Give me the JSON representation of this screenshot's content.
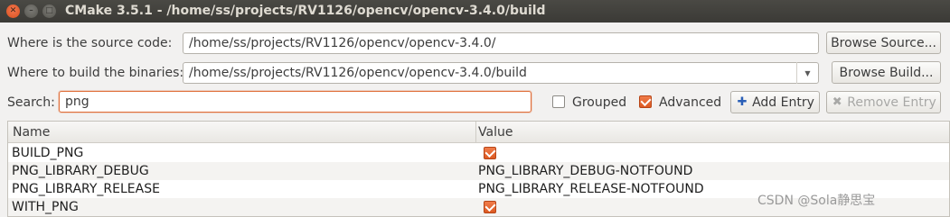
{
  "window": {
    "title": "CMake 3.5.1 - /home/ss/projects/RV1126/opencv/opencv-3.4.0/build"
  },
  "source": {
    "label": "Where is the source code:",
    "value": "/home/ss/projects/RV1126/opencv/opencv-3.4.0/",
    "browse_label": "Browse Source..."
  },
  "build": {
    "label": "Where to build the binaries:",
    "value": "/home/ss/projects/RV1126/opencv/opencv-3.4.0/build",
    "browse_label": "Browse Build..."
  },
  "search": {
    "label": "Search:",
    "value": "png"
  },
  "options": {
    "grouped": {
      "label": "Grouped",
      "checked": false
    },
    "advanced": {
      "label": "Advanced",
      "checked": true
    }
  },
  "actions": {
    "add_entry": "Add Entry",
    "remove_entry": "Remove Entry"
  },
  "table": {
    "columns": [
      "Name",
      "Value"
    ],
    "rows": [
      {
        "name": "BUILD_PNG",
        "type": "bool",
        "value": "",
        "checked": true
      },
      {
        "name": "PNG_LIBRARY_DEBUG",
        "type": "text",
        "value": "PNG_LIBRARY_DEBUG-NOTFOUND"
      },
      {
        "name": "PNG_LIBRARY_RELEASE",
        "type": "text",
        "value": "PNG_LIBRARY_RELEASE-NOTFOUND"
      },
      {
        "name": "WITH_PNG",
        "type": "bool",
        "value": "",
        "checked": true
      }
    ]
  },
  "watermark": "CSDN @Sola静思宝",
  "colors": {
    "accent": "#e06f3a",
    "titlebar": "#3c3b37",
    "window_bg": "#f2f1f0"
  },
  "icons": {
    "add": "plus-icon",
    "remove": "x-icon",
    "combo": "chevron-down-icon"
  }
}
